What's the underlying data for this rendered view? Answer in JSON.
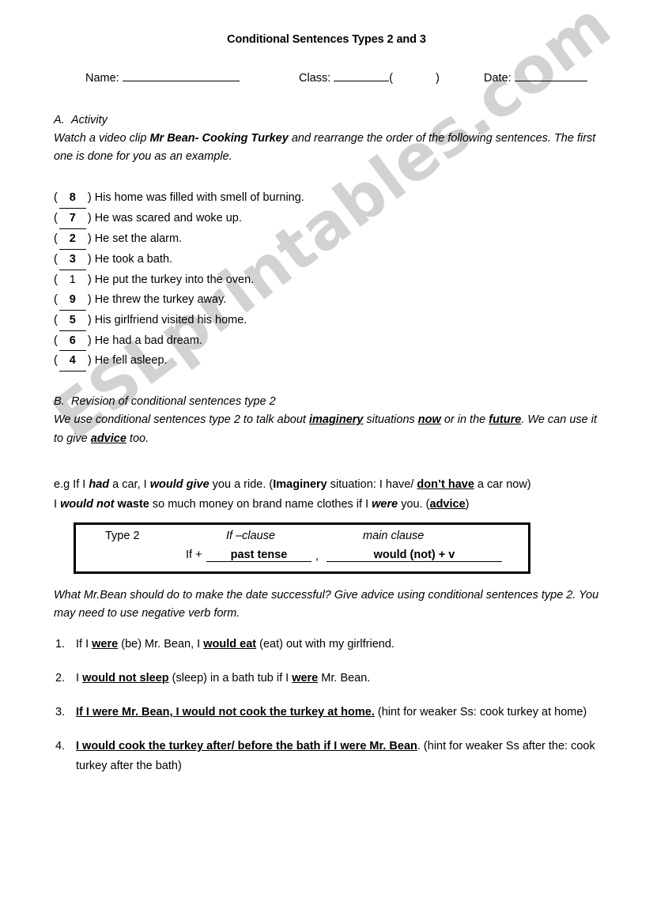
{
  "document": {
    "title": "Conditional Sentences Types 2 and 3"
  },
  "header_fields": {
    "name_label": "Name:",
    "class_label": "Class:",
    "paren_open": "(",
    "paren_close": ")",
    "date_label": "Date:"
  },
  "section_a": {
    "letter": "A.",
    "label": "Activity",
    "intro_part1": "Watch a video clip ",
    "intro_bold": "Mr Bean- Cooking Turkey",
    "intro_part2": " and rearrange the order of the following sentences. The first one is done for you as an example.",
    "items": [
      {
        "answer": "8",
        "given": false,
        "text": "His home was filled with smell of burning."
      },
      {
        "answer": "7",
        "given": false,
        "text": "He was scared and woke up."
      },
      {
        "answer": "2",
        "given": false,
        "text": "He set the alarm."
      },
      {
        "answer": "3",
        "given": false,
        "text": "He took a bath."
      },
      {
        "answer": "1",
        "given": true,
        "text": "He put the turkey into the oven."
      },
      {
        "answer": "9",
        "given": false,
        "text": "He threw the turkey away."
      },
      {
        "answer": "5",
        "given": false,
        "text": "His girlfriend visited his home."
      },
      {
        "answer": "6",
        "given": false,
        "text": "He had a bad dream."
      },
      {
        "answer": "4",
        "given": false,
        "text": "He fell asleep."
      }
    ],
    "paren_open": "(",
    "paren_close": ")"
  },
  "section_b": {
    "letter": "B.",
    "label": "Revision of conditional sentences type 2",
    "explain_1": "We use conditional sentences type 2 to talk about ",
    "explain_kw1": "imaginery",
    "explain_2": " situations ",
    "explain_kw2": "now",
    "explain_3": " or in the ",
    "explain_kw3": "future",
    "explain_4": ". We can use it to give ",
    "explain_kw4": "advice",
    "explain_5": " too."
  },
  "examples": {
    "line1_a": "e.g If I ",
    "line1_had": "had",
    "line1_b": " a car, I ",
    "line1_wouldgive": "would give",
    "line1_c": " you a ride. (",
    "line1_imaginery": "Imaginery",
    "line1_d": " situation: I have/ ",
    "line1_donthave": "don’t have",
    "line1_e": " a car now)",
    "line2_a": "I ",
    "line2_wouldnot": "would not",
    "line2_b": " ",
    "line2_waste": "waste",
    "line2_c": " so much money on brand name clothes if I ",
    "line2_were": "were",
    "line2_d": " you. (",
    "line2_advice": "advice",
    "line2_e": ")"
  },
  "formula_box": {
    "type_label": "Type 2",
    "if_clause_header": "If –clause",
    "main_clause_header": "main clause",
    "if_plus": "If +",
    "past_tense": "past tense",
    "comma": ",",
    "would_not_v": "would (not) + v"
  },
  "task": {
    "prompt": "What Mr.Bean should do to make the date successful? Give advice using conditional sentences type 2. You may need to use negative verb form.",
    "answers": [
      {
        "num": "1.",
        "pre": "If I ",
        "ans1": "were",
        "mid": " (be) Mr. Bean, I ",
        "ans2": "would eat",
        "post": " (eat) out with my girlfriend.",
        "hint": ""
      },
      {
        "num": "2.",
        "pre": "I ",
        "ans1": "would not sleep",
        "mid": " (sleep) in a bath tub if I ",
        "ans2": "were",
        "post": " Mr. Bean.",
        "hint": ""
      },
      {
        "num": "3.",
        "pre": "",
        "ans1": "If I were Mr. Bean, I would not cook the turkey at home.",
        "mid": "",
        "ans2": "",
        "post": "",
        "hint": " (hint for weaker Ss: cook turkey at home)"
      },
      {
        "num": "4.",
        "pre": "",
        "ans1": "I would cook the turkey after/ before the bath if I were Mr. Bean",
        "mid": "",
        "ans2": "",
        "post": ".",
        "hint": " (hint for weaker Ss after the: cook turkey after the bath)"
      }
    ]
  },
  "watermark": {
    "text": "ESLprintables.com",
    "color": "#d2d2d2"
  }
}
